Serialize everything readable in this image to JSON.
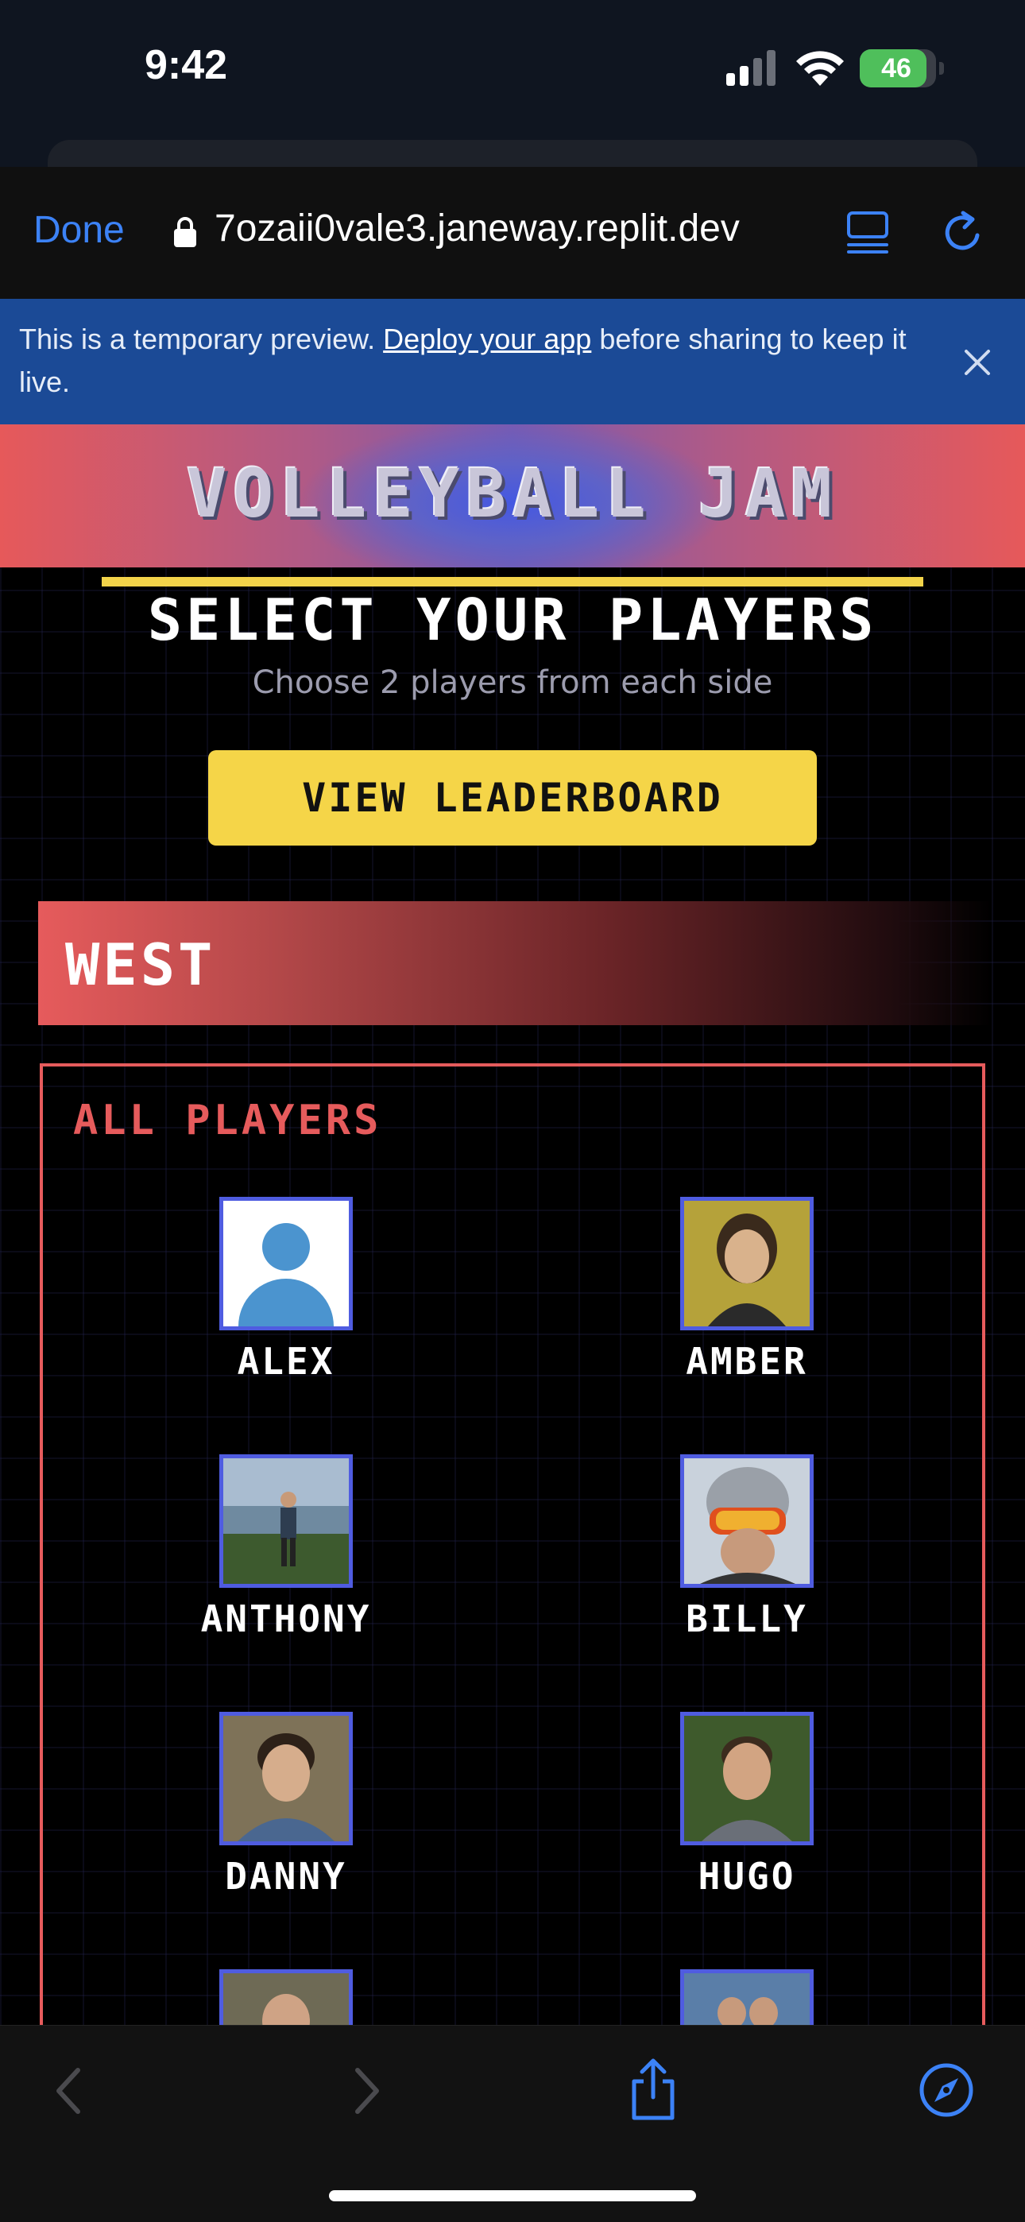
{
  "status_bar": {
    "time": "9:42",
    "battery_percent": "46",
    "icons": [
      "signal-icon",
      "wifi-icon",
      "battery-charging-icon"
    ]
  },
  "browser": {
    "done_label": "Done",
    "url": "7ozaii0vale3.janeway.replit.dev",
    "icons": [
      "lock-icon",
      "reader-mode-icon",
      "reload-icon"
    ],
    "accent_color": "#3c82f6"
  },
  "banner": {
    "text_before": "This is a temporary preview. ",
    "link_text": "Deploy your app",
    "text_after": " before sharing to keep it live.",
    "close_icon": "close-icon",
    "background_color": "#1b4a96"
  },
  "app": {
    "title": "VOLLEYBALL JAM",
    "heading": "SELECT YOUR PLAYERS",
    "subtitle": "Choose 2 players from each side",
    "leaderboard_button": "VIEW LEADERBOARD",
    "team_name": "WEST",
    "section_label": "ALL PLAYERS",
    "colors": {
      "accent_red": "#e65b5c",
      "accent_yellow": "#f5d548",
      "avatar_border": "#4f5ce0"
    },
    "players": [
      {
        "name": "ALEX",
        "avatar": "default-avatar-icon"
      },
      {
        "name": "AMBER",
        "avatar": "photo"
      },
      {
        "name": "ANTHONY",
        "avatar": "photo"
      },
      {
        "name": "BILLY",
        "avatar": "photo"
      },
      {
        "name": "DANNY",
        "avatar": "photo"
      },
      {
        "name": "HUGO",
        "avatar": "photo"
      },
      {
        "name": "",
        "avatar": "photo"
      },
      {
        "name": "",
        "avatar": "photo"
      }
    ]
  },
  "bottom_toolbar": {
    "icons": [
      "back-icon",
      "forward-icon",
      "share-icon",
      "compass-icon"
    ]
  }
}
